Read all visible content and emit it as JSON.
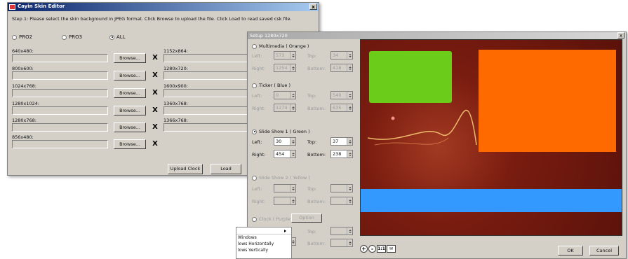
{
  "editor": {
    "title": "Cayin Skin Editor",
    "close": "x",
    "step": "Step 1: Please select the skin background in JPEG format. Click Browse to upload the file. Click Load to read saved csk file.",
    "models": [
      {
        "label": "PRO2",
        "checked": false
      },
      {
        "label": "PRO3",
        "checked": false
      },
      {
        "label": "ALL",
        "checked": true
      }
    ],
    "left_slots": [
      "640x480:",
      "800x600:",
      "1024x768:",
      "1280x1024:",
      "1280x768:",
      "856x480:"
    ],
    "right_slots": [
      "1152x864:",
      "1280x720:",
      "1600x900:",
      "1360x768:",
      "1366x768:"
    ],
    "browse": "Browse...",
    "remove": "X",
    "upload_clock": "Upload Clock",
    "load": "Load"
  },
  "setup": {
    "title": "Setup 1280x720",
    "close": "x",
    "sections": [
      {
        "label": "Multimedia ( Orange )",
        "checked": false,
        "enabled": false,
        "left_label": "Left:",
        "left": "573",
        "top_label": "Top:",
        "top": "34",
        "right_label": "Right:",
        "right": "1254",
        "bottom_label": "Bottom:",
        "bottom": "418"
      },
      {
        "label": "Ticker ( Blue )",
        "checked": false,
        "enabled": false,
        "left_label": "Left:",
        "left": "0",
        "top_label": "Top:",
        "top": "540",
        "right_label": "Right:",
        "right": "1274",
        "bottom_label": "Bottom:",
        "bottom": "635"
      },
      {
        "label": "Slide Show 1 ( Green )",
        "checked": true,
        "enabled": true,
        "left_label": "Left:",
        "left": "30",
        "top_label": "Top:",
        "top": "37",
        "right_label": "Right:",
        "right": "454",
        "bottom_label": "Bottom:",
        "bottom": "238"
      },
      {
        "label": "Slide Show 2 ( Yellow )",
        "checked": false,
        "enabled": false,
        "left_label": "Left:",
        "left": "",
        "top_label": "Top:",
        "top": "",
        "right_label": "Right:",
        "right": "",
        "bottom_label": "Bottom:",
        "bottom": ""
      }
    ],
    "clock_label": "Clock ( Purple )",
    "clock_option": "Option",
    "clock_top_label": "Top:",
    "clock_bottom_label": "Bottom:",
    "context_menu": [
      "Windows",
      "lows Horizontally",
      "lows Vertically"
    ],
    "zoom_in": "+",
    "zoom_out": "-",
    "zoom_actual": "1:1",
    "ok": "OK",
    "cancel": "Cancel",
    "colors": {
      "green": "#6ccc1a",
      "orange": "#ff6a00",
      "blue": "#3399ff",
      "background": "#7a1c10"
    }
  }
}
